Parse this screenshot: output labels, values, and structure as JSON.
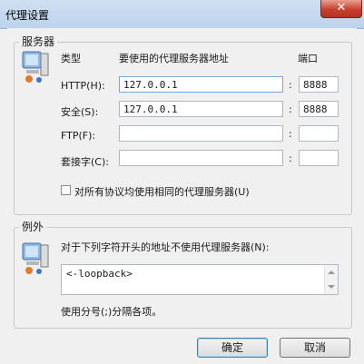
{
  "window": {
    "title": "代理设置",
    "close_symbol": "✕"
  },
  "servers": {
    "legend": "服务器",
    "icon": "network-computer-icon",
    "headers": {
      "type": "类型",
      "address": "要使用的代理服务器地址",
      "port": "端口"
    },
    "rows": [
      {
        "label": "HTTP(H):",
        "address": "127.0.0.1",
        "port": "8888"
      },
      {
        "label": "安全(S):",
        "address": "127.0.0.1",
        "port": "8888"
      },
      {
        "label": "FTP(F):",
        "address": "",
        "port": ""
      },
      {
        "label": "套接字(C):",
        "address": "",
        "port": ""
      }
    ],
    "colon": ":",
    "same_proxy_label": "对所有协议均使用相同的代理服务器(U)",
    "same_proxy_checked": false
  },
  "exceptions": {
    "legend": "例外",
    "icon": "network-computer-icon",
    "description": "对于下列字符开头的地址不使用代理服务器(N):",
    "value": "<-loopback>",
    "hint": "使用分号(;)分隔各项。"
  },
  "buttons": {
    "ok": "确定",
    "cancel": "取消"
  },
  "colors": {
    "title_bar": "#c4d8ee",
    "close_button": "#c7402d",
    "default_button_border": "#3c7fb1"
  }
}
